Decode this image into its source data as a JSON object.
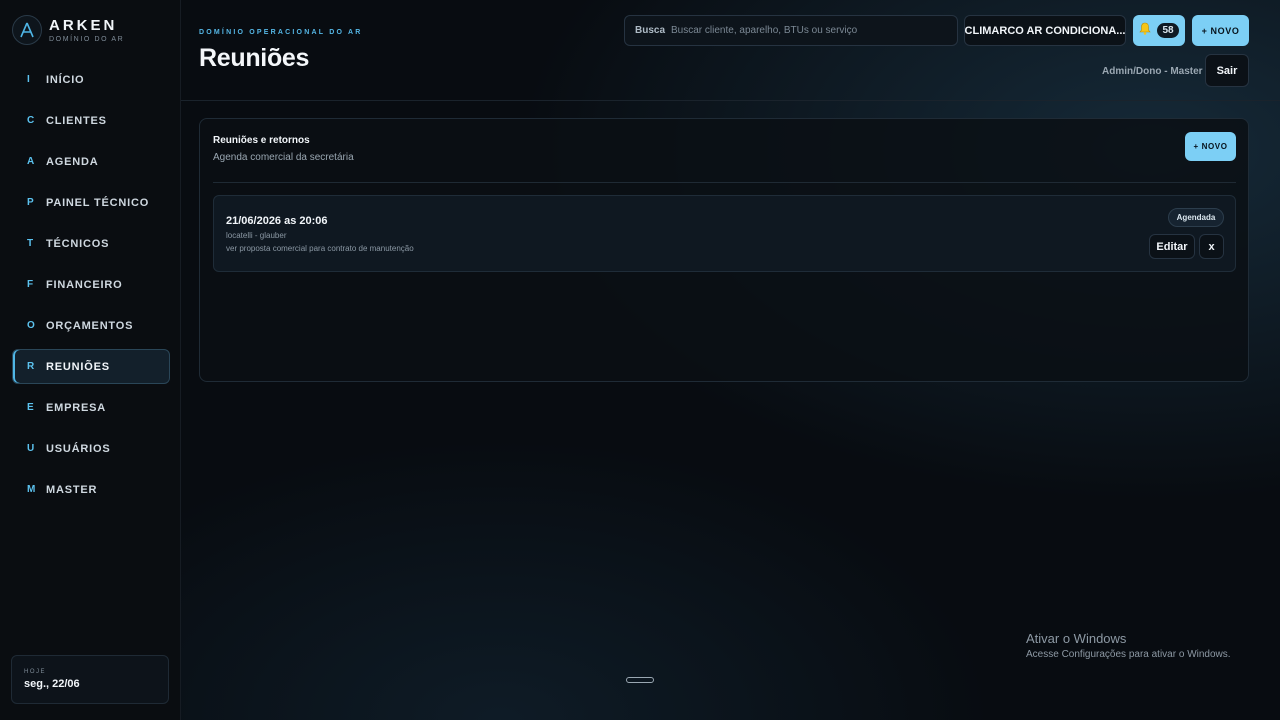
{
  "brand": {
    "name": "ARKEN",
    "tagline": "DOMÍNIO DO AR",
    "logo_icon": "triangle-a-logo-icon"
  },
  "sidebar": {
    "items": [
      {
        "key": "I",
        "label": "INÍCIO",
        "active": false
      },
      {
        "key": "C",
        "label": "CLIENTES",
        "active": false
      },
      {
        "key": "A",
        "label": "AGENDA",
        "active": false
      },
      {
        "key": "P",
        "label": "PAINEL TÉCNICO",
        "active": false
      },
      {
        "key": "T",
        "label": "TÉCNICOS",
        "active": false
      },
      {
        "key": "F",
        "label": "FINANCEIRO",
        "active": false
      },
      {
        "key": "O",
        "label": "ORÇAMENTOS",
        "active": false
      },
      {
        "key": "R",
        "label": "REUNIÕES",
        "active": true
      },
      {
        "key": "E",
        "label": "EMPRESA",
        "active": false
      },
      {
        "key": "U",
        "label": "USUÁRIOS",
        "active": false
      },
      {
        "key": "M",
        "label": "MASTER",
        "active": false
      }
    ],
    "today": {
      "label": "HOJE",
      "value": "seg., 22/06"
    }
  },
  "header": {
    "eyebrow": "DOMÍNIO OPERACIONAL DO AR",
    "title": "Reuniões",
    "search": {
      "label": "Busca",
      "placeholder": "Buscar cliente, aparelho, BTUs ou serviço"
    },
    "company_button": "CLIMARCO AR CONDICIONA...",
    "notifications": {
      "icon": "bell-icon",
      "count": "58"
    },
    "new_button": "+ NOVO",
    "user_role": "Admin/Dono - Master",
    "logout_button": "Sair"
  },
  "panel": {
    "title": "Reuniões e retornos",
    "subtitle": "Agenda comercial da secretária",
    "new_button": "+ NOVO",
    "meetings": [
      {
        "datetime": "21/06/2026 as 20:06",
        "people": "locatelli - glauber",
        "description": "ver proposta comercial para contrato de manutenção",
        "status": "Agendada",
        "edit_label": "Editar",
        "delete_label": "x"
      }
    ]
  },
  "watermark": {
    "title": "Ativar o Windows",
    "subtitle": "Acesse Configurações para ativar o Windows."
  },
  "colors": {
    "accent": "#7ccff5",
    "accent_text": "#55b7e6",
    "background": "#080c11",
    "sidebar_bg": "#0a0d11"
  }
}
